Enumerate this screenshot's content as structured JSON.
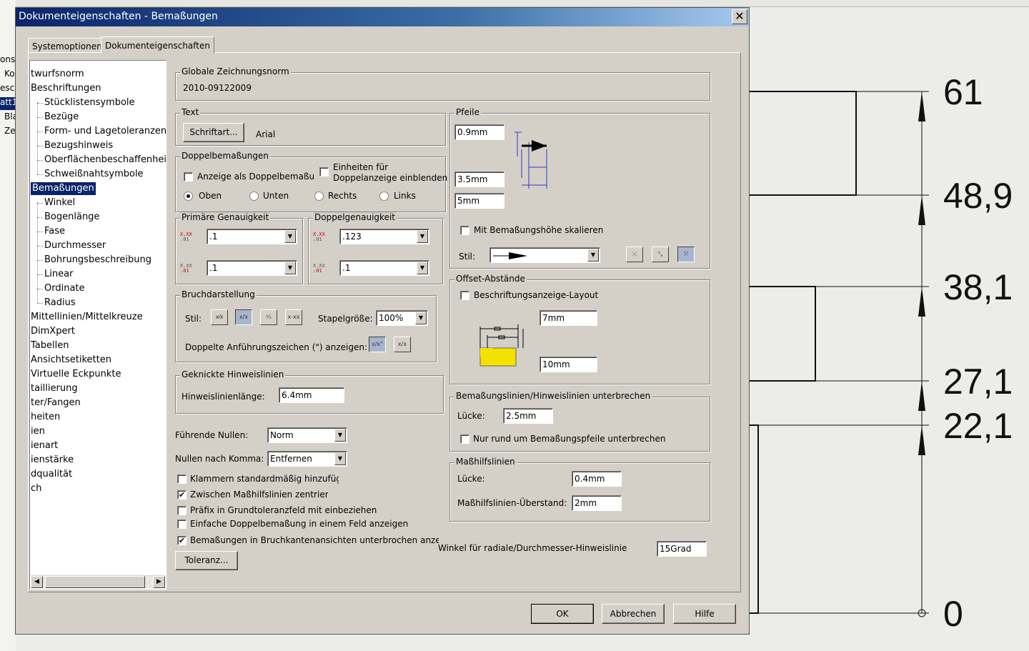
{
  "background": {
    "tree_fragments": [
      "onst",
      "Ko",
      "eschr",
      "att1",
      "Bla",
      "Ze"
    ],
    "dimensions": [
      "61",
      "48,9",
      "38,1",
      "27,1",
      "22,1",
      "0"
    ]
  },
  "dialog": {
    "title": "Dokumenteigenschaften - Bemaßungen",
    "close": "✕",
    "tabs": [
      "Systemoptionen",
      "Dokumenteigenschaften"
    ],
    "tree": [
      {
        "label": "twurfsnorm",
        "level": 0
      },
      {
        "label": "Beschriftungen",
        "level": 0
      },
      {
        "label": "Stücklistensymbole",
        "level": 1
      },
      {
        "label": "Bezüge",
        "level": 1
      },
      {
        "label": "Form- und Lagetoleranzen",
        "level": 1
      },
      {
        "label": "Bezugshinweis",
        "level": 1
      },
      {
        "label": "Oberflächenbeschaffenheit",
        "level": 1
      },
      {
        "label": "Schweißnahtsymbole",
        "level": 1
      },
      {
        "label": "Bemaßungen",
        "level": 0,
        "selected": true
      },
      {
        "label": "Winkel",
        "level": 1
      },
      {
        "label": "Bogenlänge",
        "level": 1
      },
      {
        "label": "Fase",
        "level": 1
      },
      {
        "label": "Durchmesser",
        "level": 1
      },
      {
        "label": "Bohrungsbeschreibung",
        "level": 1
      },
      {
        "label": "Linear",
        "level": 1
      },
      {
        "label": "Ordinate",
        "level": 1
      },
      {
        "label": "Radius",
        "level": 1
      },
      {
        "label": "Mittellinien/Mittelkreuze",
        "level": 0
      },
      {
        "label": "DimXpert",
        "level": 0
      },
      {
        "label": "Tabellen",
        "level": 0
      },
      {
        "label": "Ansichtsetiketten",
        "level": 0
      },
      {
        "label": "Virtuelle Eckpunkte",
        "level": 0
      },
      {
        "label": "taillierung",
        "level": 0
      },
      {
        "label": "ter/Fangen",
        "level": 0
      },
      {
        "label": "heiten",
        "level": 0
      },
      {
        "label": "ien",
        "level": 0
      },
      {
        "label": "ienart",
        "level": 0
      },
      {
        "label": "ienstärke",
        "level": 0
      },
      {
        "label": "dqualität",
        "level": 0
      },
      {
        "label": "ch",
        "level": 0
      }
    ],
    "scroll_left": "◀",
    "scroll_right": "▶",
    "global_norm": {
      "legend": "Globale Zeichnungsnorm",
      "value": "2010-09122009"
    },
    "text": {
      "legend": "Text",
      "font_button": "Schriftart...",
      "font_name": "Arial"
    },
    "dual": {
      "legend": "Doppelbemaßungen",
      "show_dual": "Anzeige als Doppelbemaßung",
      "units_line1": "Einheiten für",
      "units_line2": "Doppelanzeige einblenden",
      "radios": [
        "Oben",
        "Unten",
        "Rechts",
        "Links"
      ],
      "selected": "Oben"
    },
    "primary_precision": {
      "legend": "Primäre Genauigkeit",
      "value1": ".1",
      "value2": ".1"
    },
    "dual_precision": {
      "legend": "Doppelgenauigkeit",
      "value1": ".123",
      "value2": ".1"
    },
    "fraction": {
      "legend": "Bruchdarstellung",
      "style_label": "Stil:",
      "stack_label": "Stapelgröße:",
      "stack_value": "100%",
      "double_quote_label": "Doppelte Anführungszeichen (\") anzeigen:"
    },
    "leaders": {
      "legend": "Geknickte Hinweislinien",
      "length_label": "Hinweislinienlänge:",
      "length_value": "6.4mm"
    },
    "zeros": {
      "leading_label": "Führende Nullen:",
      "leading_value": "Norm",
      "trailing_label": "Nullen nach Komma:",
      "trailing_value": "Entfernen"
    },
    "options": [
      {
        "label": "Klammern standardmäßig hinzufügen",
        "checked": false
      },
      {
        "label": "Zwischen Maßhilfslinien zentrieren",
        "checked": true
      },
      {
        "label": "Präfix in Grundtoleranzfeld mit einbeziehen",
        "checked": false
      },
      {
        "label": "Einfache Doppelbemaßung in einem Feld anzeigen",
        "checked": false
      },
      {
        "label": "Bemaßungen in Bruchkantenansichten unterbrochen anzeigen",
        "checked": true
      }
    ],
    "check_mark": "✔",
    "tolerance_button": "Toleranz...",
    "arrows": {
      "legend": "Pfeile",
      "v1": "0.9mm",
      "v2": "3.5mm",
      "v3": "5mm",
      "scale_label": "Mit Bemaßungshöhe skalieren",
      "style_label": "Stil:"
    },
    "offset": {
      "legend": "Offset-Abstände",
      "layout_label": "Beschriftungsanzeige-Layout",
      "v1": "7mm",
      "v2": "10mm"
    },
    "break": {
      "legend": "Bemaßungslinien/Hinweislinien unterbrechen",
      "gap_label": "Lücke:",
      "gap_value": "2.5mm",
      "only_label": "Nur rund um Bemaßungspfeile unterbrechen"
    },
    "ext": {
      "legend": "Maßhilfslinien",
      "gap_label": "Lücke:",
      "gap_value": "0.4mm",
      "overshoot_label": "Maßhilfslinien-Überstand:",
      "overshoot_value": "2mm"
    },
    "radial": {
      "label": "Winkel für radiale/Durchmesser-Hinweislinie",
      "value": "15Grad"
    },
    "buttons": {
      "ok": "OK",
      "cancel": "Abbrechen",
      "help": "Hilfe"
    },
    "dropdown_arrow": "▼",
    "colors": {
      "title_start": "#0a246a",
      "title_end": "#a6caf0",
      "selection": "#0a246a",
      "face": "#d4d0c8"
    }
  }
}
